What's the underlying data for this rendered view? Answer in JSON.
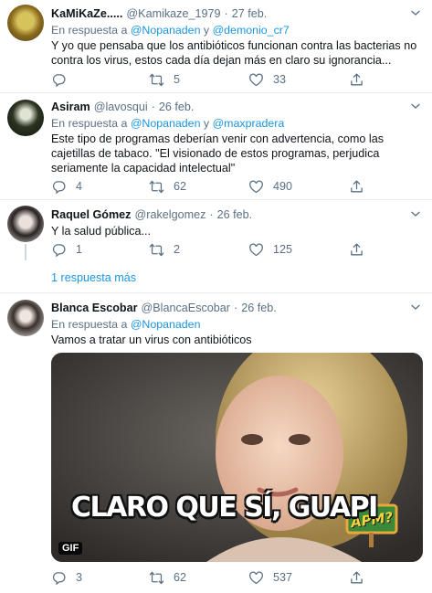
{
  "tweets": [
    {
      "name": "KaMiKaZe.....",
      "handle": "@Kamikaze_1979",
      "date": "27 feb.",
      "reply_prefix": "En respuesta a",
      "reply_user1": "@Nopanaden",
      "reply_and": "y",
      "reply_user2": "@demonio_cr7",
      "text": "Y yo que pensaba que los antibióticos funcionan contra las bacterias no contra los virus, estos cada día dejan más en claro su ignorancia...",
      "replies": "",
      "retweets": "5",
      "likes": "33"
    },
    {
      "name": "Asiram",
      "handle": "@lavosqui",
      "date": "26 feb.",
      "reply_prefix": "En respuesta a",
      "reply_user1": "@Nopanaden",
      "reply_and": "y",
      "reply_user2": "@maxpradera",
      "text": "Este tipo de programas deberían venir con advertencia, como las cajetillas de tabaco. \"El visionado de estos programas, perjudica seriamente la capacidad intelectual\"",
      "replies": "4",
      "retweets": "62",
      "likes": "490"
    },
    {
      "name": "Raquel Gómez",
      "handle": "@rakelgomez",
      "date": "26 feb.",
      "text": "Y la salud pública...",
      "replies": "1",
      "retweets": "2",
      "likes": "125"
    },
    {
      "name": "Blanca Escobar",
      "handle": "@BlancaEscobar",
      "date": "26 feb.",
      "reply_prefix": "En respuesta a",
      "reply_user1": "@Nopanaden",
      "text": "Vamos a tratar un virus con antibióticos",
      "gif_caption": "CLARO QUE SÍ, GUAPI",
      "gif_badge": "GIF",
      "gif_sign": "APM?",
      "replies": "3",
      "retweets": "62",
      "likes": "537"
    }
  ],
  "more_replies": "1 respuesta más",
  "colors": {
    "accent": "#1b95e0",
    "muted": "#5b7083",
    "divider": "#e6ecf0"
  },
  "icons": [
    "caret-down-icon",
    "reply-icon",
    "retweet-icon",
    "like-icon",
    "share-icon"
  ]
}
